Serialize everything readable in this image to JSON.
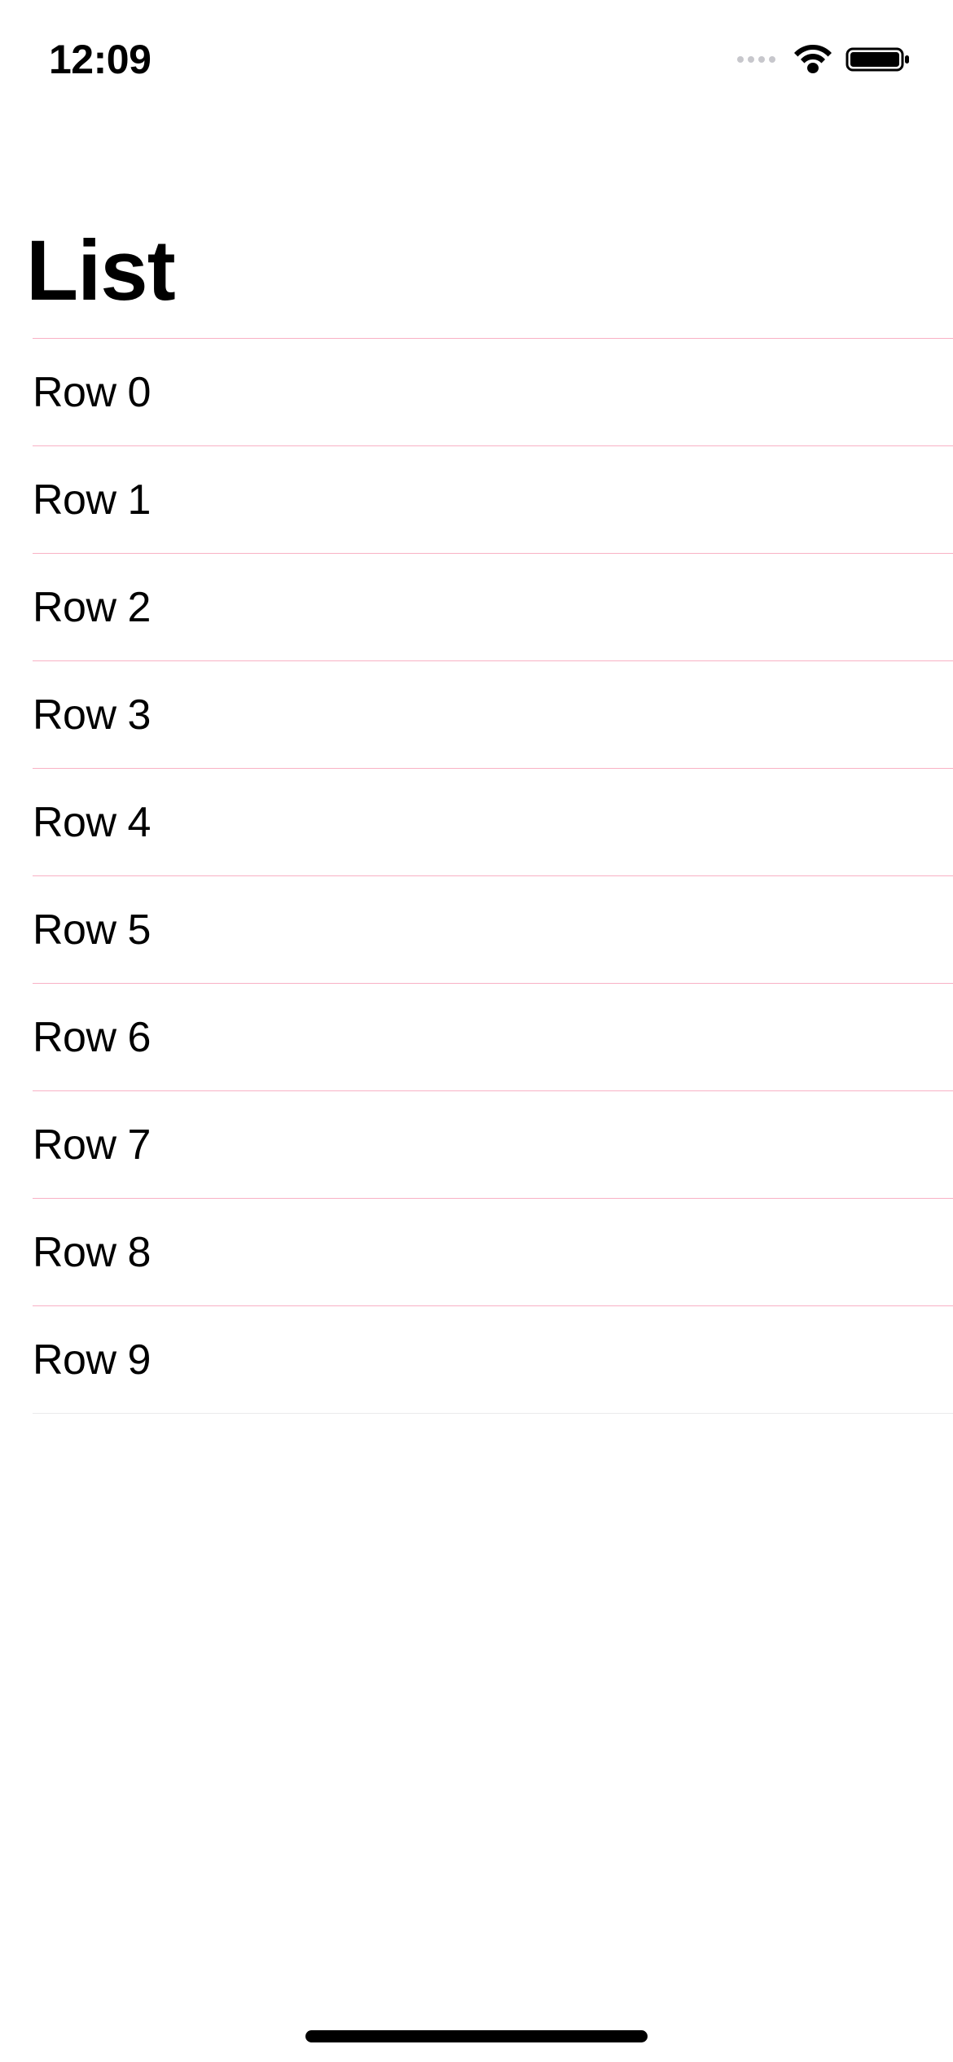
{
  "status": {
    "time": "12:09"
  },
  "header": {
    "title": "List"
  },
  "list": {
    "rows": [
      {
        "label": "Row 0"
      },
      {
        "label": "Row 1"
      },
      {
        "label": "Row 2"
      },
      {
        "label": "Row 3"
      },
      {
        "label": "Row 4"
      },
      {
        "label": "Row 5"
      },
      {
        "label": "Row 6"
      },
      {
        "label": "Row 7"
      },
      {
        "label": "Row 8"
      },
      {
        "label": "Row 9"
      }
    ]
  },
  "colors": {
    "separator": "#f9b1c5",
    "background": "#ffffff"
  }
}
